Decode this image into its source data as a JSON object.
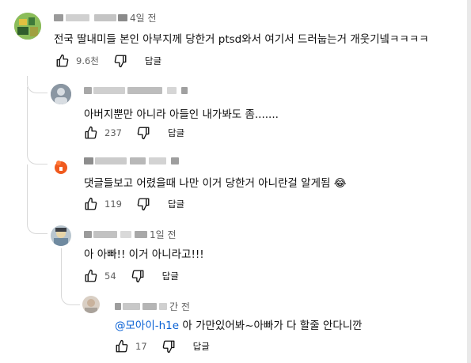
{
  "comments": [
    {
      "time": "4일 전",
      "text": "전국 딸내미들 본인 아부지께 당한거 ptsd와서 여기서 드러눕는거 개웃기넼ㅋㅋㅋㅋ",
      "likes": "9.6천",
      "reply_label": "답글"
    },
    {
      "time": "",
      "text": "아버지뿐만 아니라 아들인 내가봐도 좀.......",
      "likes": "237",
      "reply_label": "답글"
    },
    {
      "time": "",
      "text": "댓글들보고 어렸을때 나만 이거 당한거 아니란걸 알게됨 😂",
      "likes": "119",
      "reply_label": "답글"
    },
    {
      "time": "1일 전",
      "text": "아 아빠!! 이거 아니라고!!!",
      "likes": "54",
      "reply_label": "답글"
    },
    {
      "time": "간 전",
      "mention": "@모아이-h1e",
      "text": " 아 가만있어봐~아빠가 다 할줄 안다니깐",
      "likes": "17",
      "reply_label": "답글"
    }
  ],
  "icons": {
    "like": "thumbs-up-icon",
    "dislike": "thumbs-down-icon"
  },
  "colors": {
    "mention": "#065fd4",
    "meta": "#606060",
    "thread_line": "#d8d8d8"
  }
}
